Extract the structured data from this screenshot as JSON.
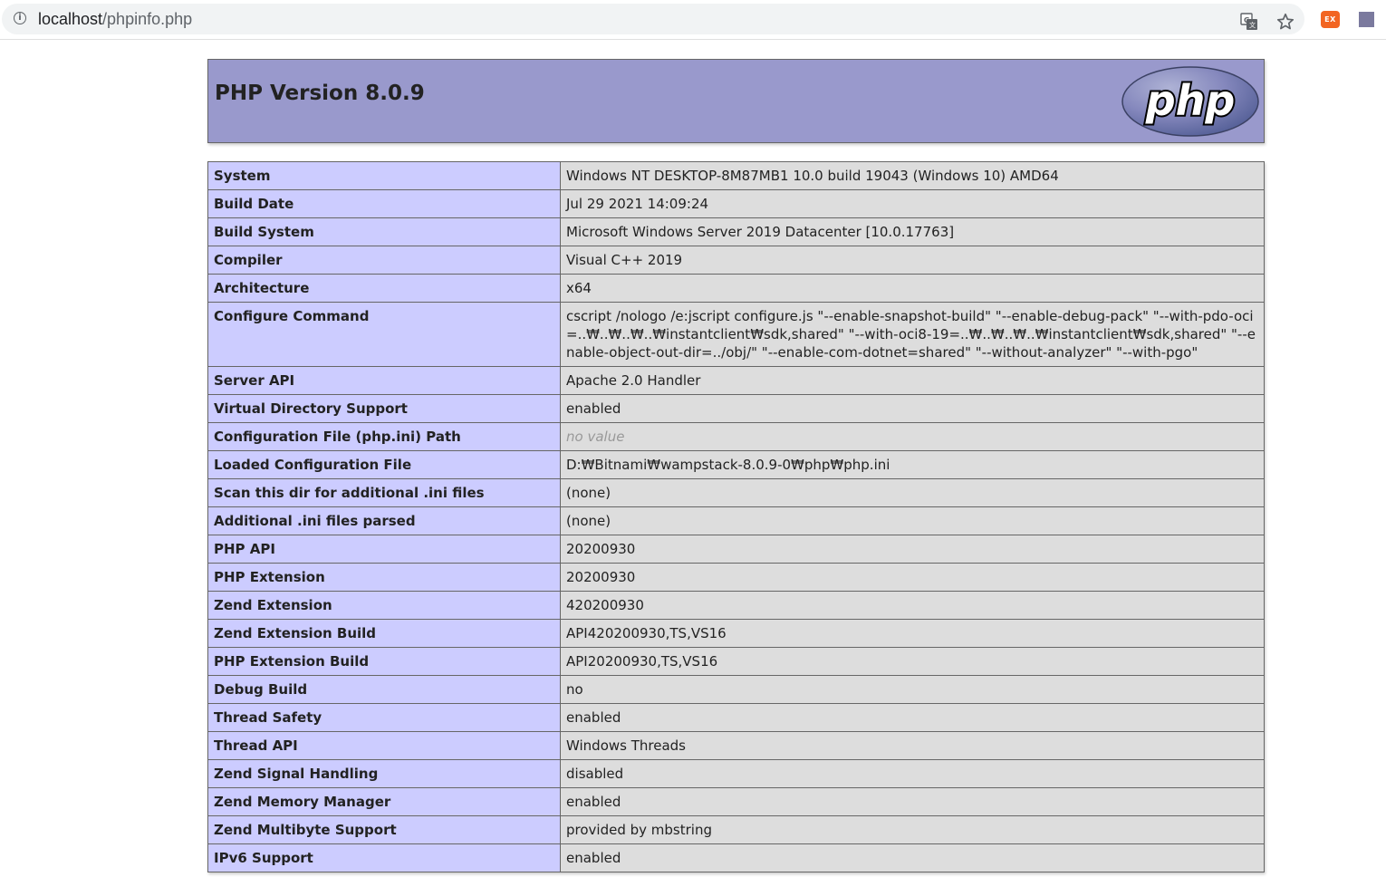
{
  "browser": {
    "url_host": "localhost",
    "url_path": "/phpinfo.php",
    "extension_label": "EX"
  },
  "header": {
    "title": "PHP Version 8.0.9",
    "logo_text": "php"
  },
  "rows": [
    {
      "label": "System",
      "value": "Windows NT DESKTOP-8M87MB1 10.0 build 19043 (Windows 10) AMD64"
    },
    {
      "label": "Build Date",
      "value": "Jul 29 2021 14:09:24"
    },
    {
      "label": "Build System",
      "value": "Microsoft Windows Server 2019 Datacenter [10.0.17763]"
    },
    {
      "label": "Compiler",
      "value": "Visual C++ 2019"
    },
    {
      "label": "Architecture",
      "value": "x64"
    },
    {
      "label": "Configure Command",
      "value": "cscript /nologo /e:jscript configure.js \"--enable-snapshot-build\" \"--enable-debug-pack\" \"--with-pdo-oci=..₩..₩..₩..₩instantclient₩sdk,shared\" \"--with-oci8-19=..₩..₩..₩..₩instantclient₩sdk,shared\" \"--enable-object-out-dir=../obj/\" \"--enable-com-dotnet=shared\" \"--without-analyzer\" \"--with-pgo\""
    },
    {
      "label": "Server API",
      "value": "Apache 2.0 Handler"
    },
    {
      "label": "Virtual Directory Support",
      "value": "enabled"
    },
    {
      "label": "Configuration File (php.ini) Path",
      "value": "no value",
      "novalue": true
    },
    {
      "label": "Loaded Configuration File",
      "value": "D:₩Bitnami₩wampstack-8.0.9-0₩php₩php.ini"
    },
    {
      "label": "Scan this dir for additional .ini files",
      "value": "(none)"
    },
    {
      "label": "Additional .ini files parsed",
      "value": "(none)"
    },
    {
      "label": "PHP API",
      "value": "20200930"
    },
    {
      "label": "PHP Extension",
      "value": "20200930"
    },
    {
      "label": "Zend Extension",
      "value": "420200930"
    },
    {
      "label": "Zend Extension Build",
      "value": "API420200930,TS,VS16"
    },
    {
      "label": "PHP Extension Build",
      "value": "API20200930,TS,VS16"
    },
    {
      "label": "Debug Build",
      "value": "no"
    },
    {
      "label": "Thread Safety",
      "value": "enabled"
    },
    {
      "label": "Thread API",
      "value": "Windows Threads"
    },
    {
      "label": "Zend Signal Handling",
      "value": "disabled"
    },
    {
      "label": "Zend Memory Manager",
      "value": "enabled"
    },
    {
      "label": "Zend Multibyte Support",
      "value": "provided by mbstring"
    },
    {
      "label": "IPv6 Support",
      "value": "enabled"
    }
  ]
}
